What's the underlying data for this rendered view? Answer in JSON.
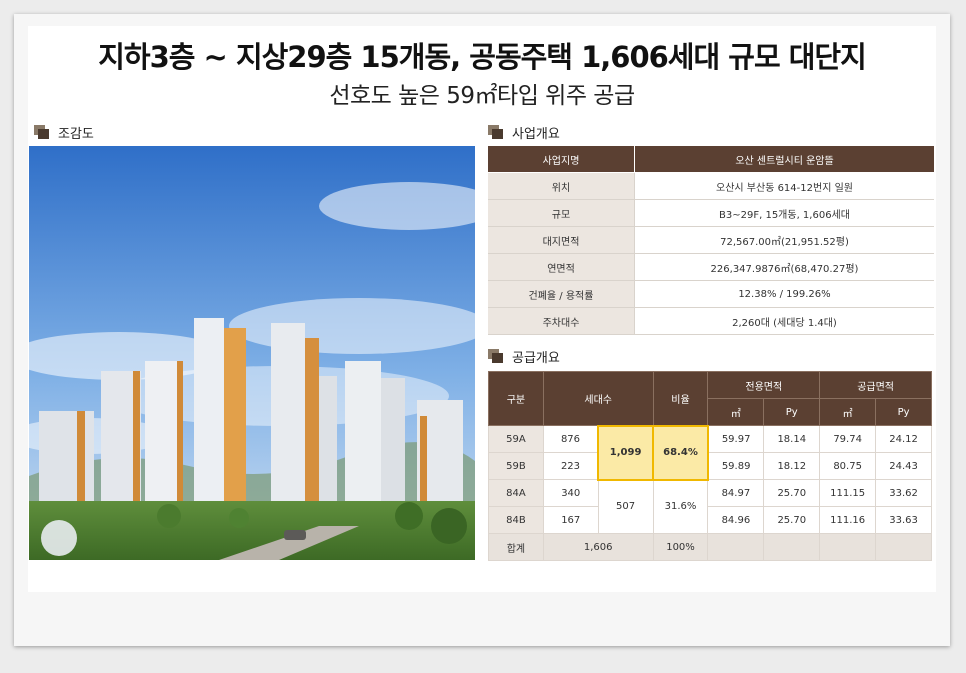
{
  "title": "지하3층 ~ 지상29층 15개동, 공동주택 1,606세대 규모 대단지",
  "subtitle": "선호도 높은 59㎡타입 위주 공급",
  "sections": {
    "birdseye": "조감도",
    "overview": "사업개요",
    "supply": "공급개요"
  },
  "overview": {
    "header": {
      "label": "사업지명",
      "value": "오산 센트럴시티 운암뜰"
    },
    "rows": [
      {
        "label": "위치",
        "value": "오산시 부산동 614-12번지 일원"
      },
      {
        "label": "규모",
        "value": "B3~29F, 15개동, 1,606세대"
      },
      {
        "label": "대지면적",
        "value": "72,567.00㎡(21,951.52평)"
      },
      {
        "label": "연면적",
        "value": "226,347.9876㎡(68,470.27평)"
      },
      {
        "label": "건폐율 / 용적률",
        "value": "12.38% / 199.26%"
      },
      {
        "label": "주차대수",
        "value": "2,260대 (세대당 1.4대)"
      }
    ]
  },
  "supply": {
    "headers": {
      "type": "구분",
      "households": "세대수",
      "ratio": "비율",
      "exclusive": "전용면적",
      "supplyArea": "공급면적",
      "sqm": "㎡",
      "py": "Py"
    },
    "rows": [
      {
        "type": "59A",
        "households": "876",
        "exSqm": "59.97",
        "exPy": "18.14",
        "spSqm": "79.74",
        "spPy": "24.12"
      },
      {
        "type": "59B",
        "households": "223",
        "exSqm": "59.89",
        "exPy": "18.12",
        "spSqm": "80.75",
        "spPy": "24.43"
      },
      {
        "type": "84A",
        "households": "340",
        "exSqm": "84.97",
        "exPy": "25.70",
        "spSqm": "111.15",
        "spPy": "33.62"
      },
      {
        "type": "84B",
        "households": "167",
        "exSqm": "84.96",
        "exPy": "25.70",
        "spSqm": "111.16",
        "spPy": "33.63"
      }
    ],
    "group59": {
      "households": "1,099",
      "ratio": "68.4%"
    },
    "group84": {
      "households": "507",
      "ratio": "31.6%"
    },
    "total": {
      "label": "합계",
      "households": "1,606",
      "ratio": "100%"
    }
  },
  "colors": {
    "tableHeader": "#5b4032",
    "labelCell": "#ece6e0",
    "highlight": "#fbeaa6",
    "highlightBorder": "#f0b800"
  }
}
